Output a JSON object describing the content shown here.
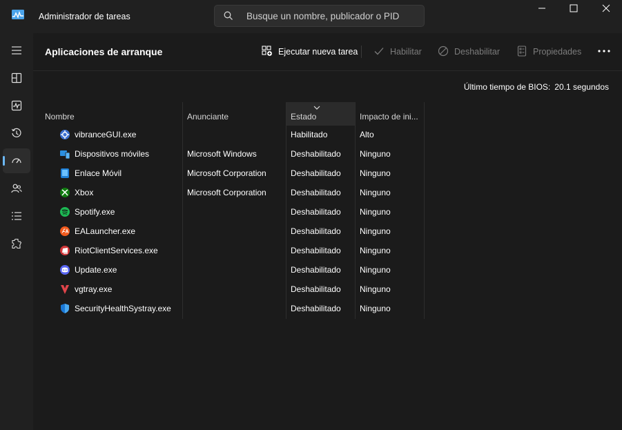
{
  "window": {
    "title": "Administrador de tareas",
    "search_placeholder": "Busque un nombre, publicador o PID"
  },
  "nav": {
    "items": [
      {
        "icon": "hamburger-menu-icon"
      },
      {
        "icon": "processes-icon"
      },
      {
        "icon": "performance-icon"
      },
      {
        "icon": "app-history-icon"
      },
      {
        "icon": "startup-apps-icon",
        "active": true
      },
      {
        "icon": "users-icon"
      },
      {
        "icon": "details-icon"
      },
      {
        "icon": "services-icon"
      }
    ]
  },
  "toolbar": {
    "page_title": "Aplicaciones de arranque",
    "run_task": "Ejecutar nueva tarea",
    "enable": "Habilitar",
    "disable": "Deshabilitar",
    "properties": "Propiedades"
  },
  "bios": {
    "label": "Último tiempo de BIOS:",
    "value": "20.1 segundos"
  },
  "table": {
    "columns": [
      "Nombre",
      "Anunciante",
      "Estado",
      "Impacto de ini..."
    ],
    "sorted_column": "Estado",
    "rows": [
      {
        "name": "vibranceGUI.exe",
        "publisher": "",
        "state": "Habilitado",
        "impact": "Alto",
        "icon": "vibrance-icon",
        "color": "#3b6fd1"
      },
      {
        "name": "Dispositivos móviles",
        "publisher": "Microsoft Windows",
        "state": "Deshabilitado",
        "impact": "Ninguno",
        "icon": "mobile-devices-icon",
        "color": "#2b8fe0"
      },
      {
        "name": "Enlace Móvil",
        "publisher": "Microsoft Corporation",
        "state": "Deshabilitado",
        "impact": "Ninguno",
        "icon": "phone-link-icon",
        "color": "#1e7fd6"
      },
      {
        "name": "Xbox",
        "publisher": "Microsoft Corporation",
        "state": "Deshabilitado",
        "impact": "Ninguno",
        "icon": "xbox-icon",
        "color": "#107c10"
      },
      {
        "name": "Spotify.exe",
        "publisher": "",
        "state": "Deshabilitado",
        "impact": "Ninguno",
        "icon": "spotify-icon",
        "color": "#1db954"
      },
      {
        "name": "EALauncher.exe",
        "publisher": "",
        "state": "Deshabilitado",
        "impact": "Ninguno",
        "icon": "ea-icon",
        "color": "#f25a1d"
      },
      {
        "name": "RiotClientServices.exe",
        "publisher": "",
        "state": "Deshabilitado",
        "impact": "Ninguno",
        "icon": "riot-icon",
        "color": "#d13639"
      },
      {
        "name": "Update.exe",
        "publisher": "",
        "state": "Deshabilitado",
        "impact": "Ninguno",
        "icon": "discord-icon",
        "color": "#5865f2"
      },
      {
        "name": "vgtray.exe",
        "publisher": "",
        "state": "Deshabilitado",
        "impact": "Ninguno",
        "icon": "vanguard-icon",
        "color": "#e0444a"
      },
      {
        "name": "SecurityHealthSystray.exe",
        "publisher": "",
        "state": "Deshabilitado",
        "impact": "Ninguno",
        "icon": "windows-security-icon",
        "color": "#1a78d6"
      }
    ]
  }
}
